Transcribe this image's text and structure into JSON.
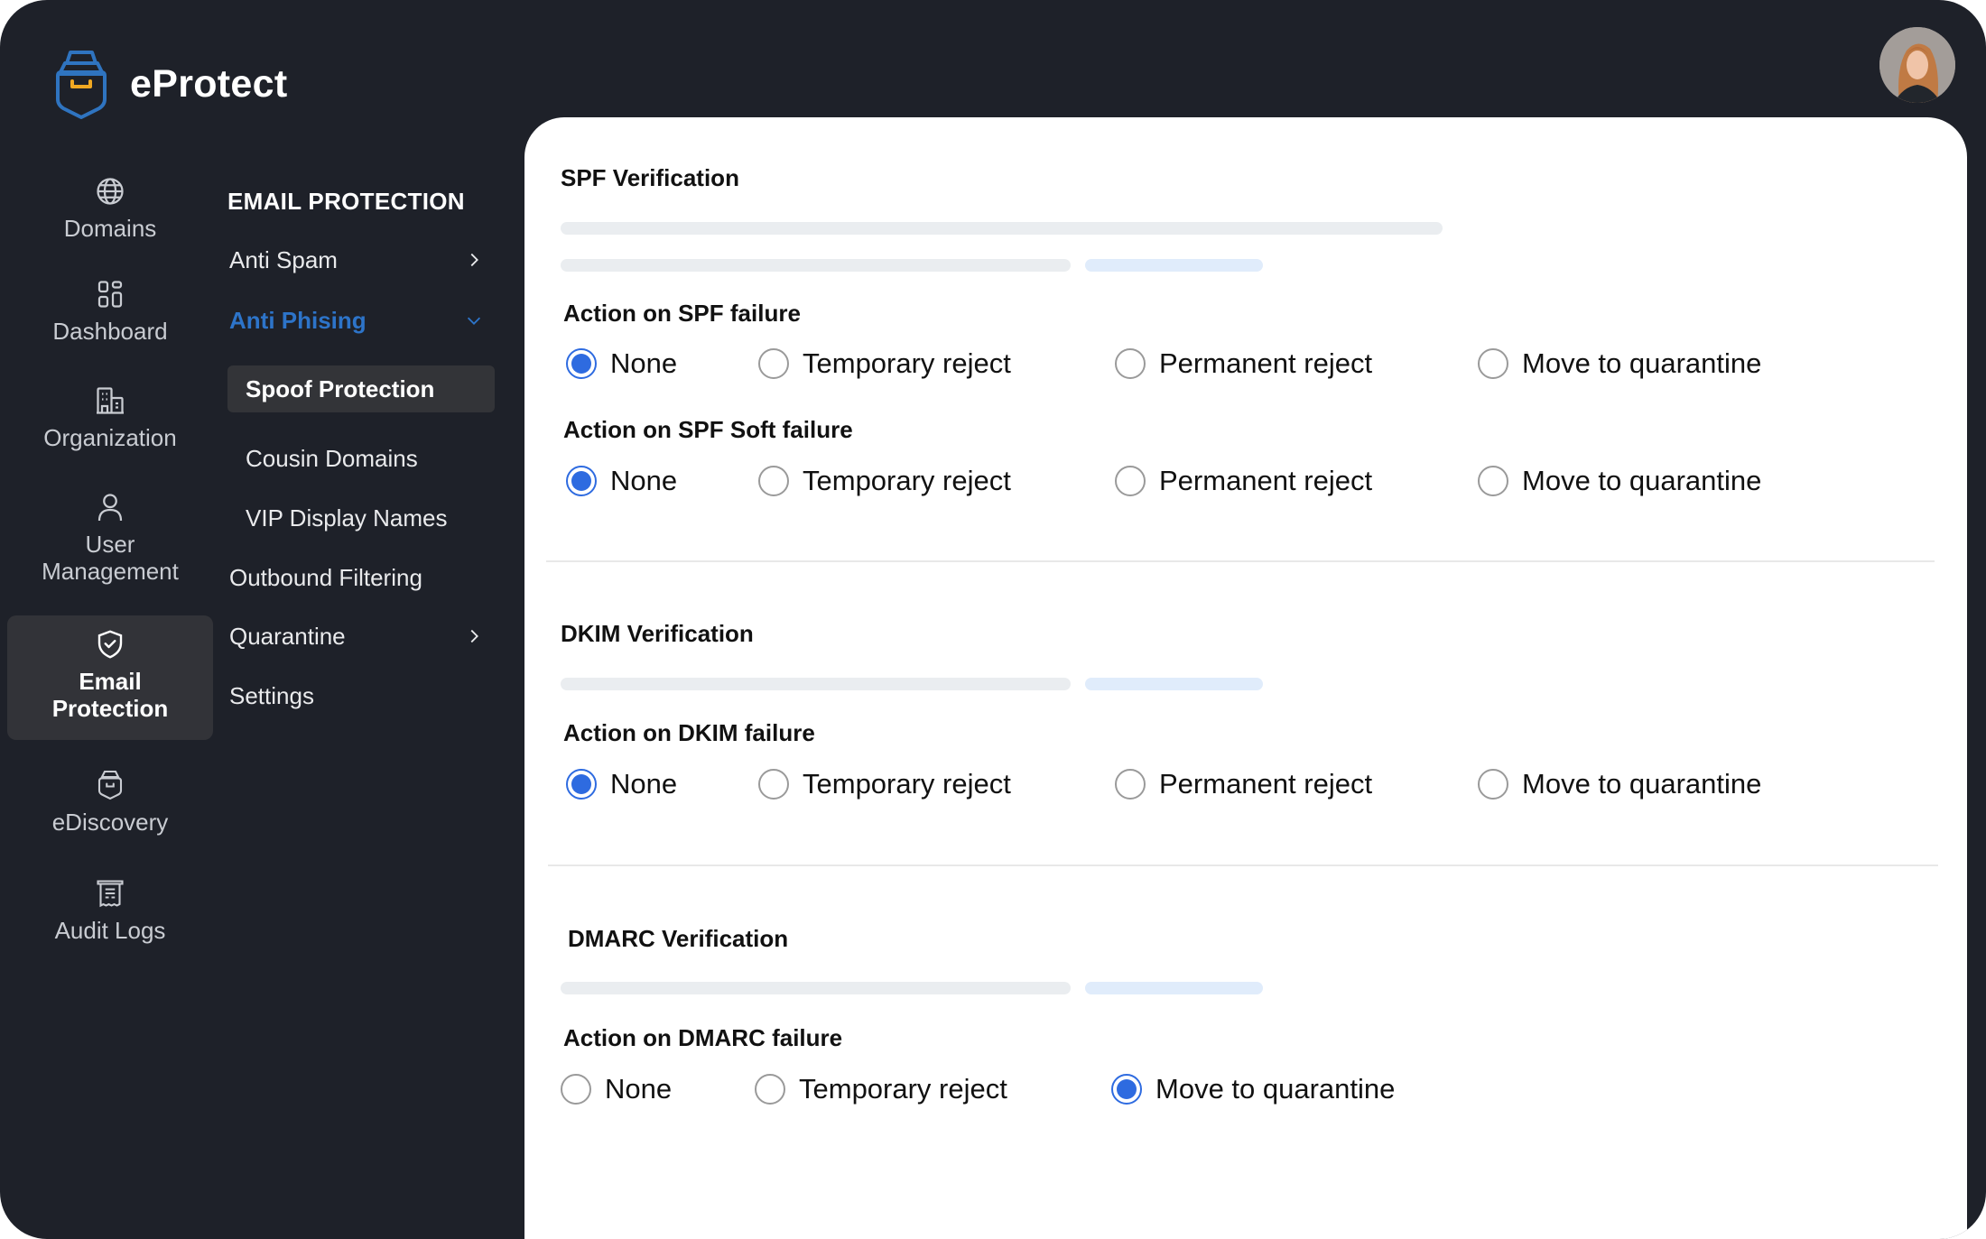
{
  "app": {
    "name": "eProtect"
  },
  "user": {
    "avatar_alt": "User avatar"
  },
  "rail": {
    "items": [
      {
        "label": "Domains",
        "icon": "globe-icon"
      },
      {
        "label": "Dashboard",
        "icon": "grid-icon"
      },
      {
        "label": "Organization",
        "icon": "building-icon"
      },
      {
        "label": "User Management",
        "icon": "user-icon"
      },
      {
        "label": "Email Protection",
        "icon": "shield-check-icon",
        "active": true
      },
      {
        "label": "eDiscovery",
        "icon": "ediscovery-icon"
      },
      {
        "label": "Audit Logs",
        "icon": "receipt-icon"
      }
    ]
  },
  "subnav": {
    "title": "EMAIL PROTECTION",
    "items": [
      {
        "label": "Anti Spam",
        "chevron": "right"
      },
      {
        "label": "Anti Phising",
        "chevron": "down",
        "expanded": true
      },
      {
        "label": "Spoof Protection",
        "sub": true,
        "active": true
      },
      {
        "label": "Cousin Domains",
        "sub": true
      },
      {
        "label": "VIP Display Names",
        "sub": true
      },
      {
        "label": "Outbound Filtering"
      },
      {
        "label": "Quarantine",
        "chevron": "right"
      },
      {
        "label": "Settings"
      }
    ]
  },
  "accent_color": "#2e6be0",
  "sections": {
    "spf": {
      "title": "SPF Verification",
      "groups": [
        {
          "label": "Action on SPF failure",
          "options": [
            "None",
            "Temporary reject",
            "Permanent reject",
            "Move to quarantine"
          ],
          "selected": "None"
        },
        {
          "label": "Action on SPF Soft failure",
          "options": [
            "None",
            "Temporary reject",
            "Permanent reject",
            "Move to quarantine"
          ],
          "selected": "None"
        }
      ]
    },
    "dkim": {
      "title": "DKIM Verification",
      "groups": [
        {
          "label": "Action on DKIM failure",
          "options": [
            "None",
            "Temporary reject",
            "Permanent reject",
            "Move to quarantine"
          ],
          "selected": "None"
        }
      ]
    },
    "dmarc": {
      "title": "DMARC Verification",
      "groups": [
        {
          "label": "Action on DMARC failure",
          "options": [
            "None",
            "Temporary reject",
            "Move to quarantine"
          ],
          "selected": "Move to quarantine"
        }
      ]
    }
  }
}
